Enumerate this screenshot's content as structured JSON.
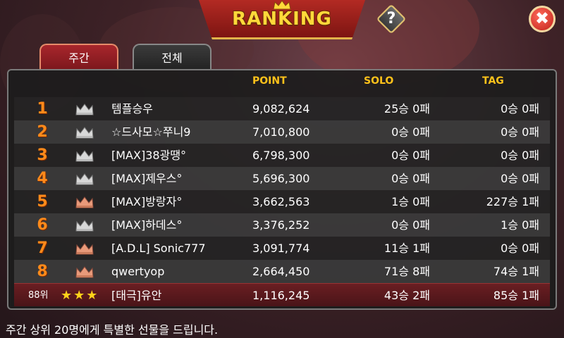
{
  "title": "RANKING",
  "help_icon": "?",
  "close_icon": "✖",
  "tabs": {
    "weekly": "주간",
    "all": "전체"
  },
  "columns": {
    "point": "POINT",
    "solo": "SOLO",
    "tag": "TAG"
  },
  "rows": [
    {
      "rank": "1",
      "crown": "silver",
      "name": "템플승우",
      "point": "9,082,624",
      "solo": "25승 0패",
      "tag": "0승 0패"
    },
    {
      "rank": "2",
      "crown": "silver",
      "name": "☆드사모☆쭈니9",
      "point": "7,010,800",
      "solo": "0승 0패",
      "tag": "0승 0패"
    },
    {
      "rank": "3",
      "crown": "silver",
      "name": "[MAX]38광땡°",
      "point": "6,798,300",
      "solo": "0승 0패",
      "tag": "0승 0패"
    },
    {
      "rank": "4",
      "crown": "silver",
      "name": "[MAX]제우스°",
      "point": "5,696,300",
      "solo": "0승 0패",
      "tag": "0승 0패"
    },
    {
      "rank": "5",
      "crown": "bronze",
      "name": "[MAX]방랑자°",
      "point": "3,662,563",
      "solo": "1승 0패",
      "tag": "227승 1패"
    },
    {
      "rank": "6",
      "crown": "silver",
      "name": "[MAX]하데스°",
      "point": "3,376,252",
      "solo": "0승 0패",
      "tag": "1승 0패"
    },
    {
      "rank": "7",
      "crown": "bronze",
      "name": "[A.D.L] Sonic777",
      "point": "3,091,774",
      "solo": "11승 1패",
      "tag": "0승 0패"
    },
    {
      "rank": "8",
      "crown": "bronze",
      "name": "qwertyop",
      "point": "2,664,450",
      "solo": "71승 8패",
      "tag": "74승 1패"
    }
  ],
  "my_rank": {
    "rank": "88위",
    "stars": "★★★",
    "name": "[태극]유안",
    "point": "1,116,245",
    "solo": "43승 2패",
    "tag": "85승 1패"
  },
  "footer": "주간 상위 20명에게 특별한 선물을 드립니다.",
  "colors": {
    "accent": "#ffc21a",
    "rank_number": "#ff8a1a",
    "silver_crown": "#d8d8d8",
    "bronze_crown": "#e89a7a"
  }
}
